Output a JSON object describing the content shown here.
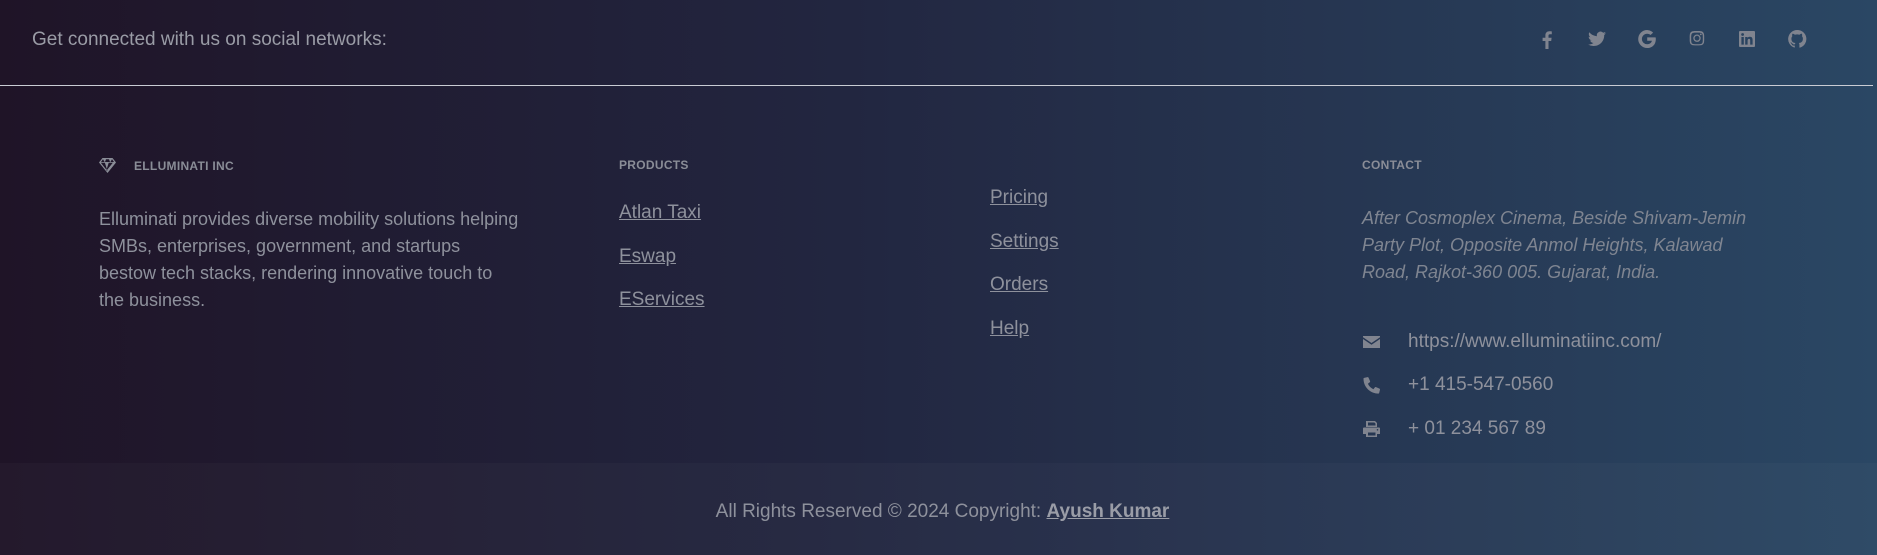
{
  "topbar": {
    "connect_text": "Get connected with us on social networks:",
    "social_icons": [
      "facebook-icon",
      "twitter-icon",
      "google-icon",
      "instagram-icon",
      "linkedin-icon",
      "github-icon"
    ]
  },
  "company": {
    "name": "ELLUMINATI INC",
    "logo_icon": "gem-icon",
    "description": "Elluminati provides diverse mobility solutions helping SMBs, enterprises, government, and startups bestow tech stacks, rendering innovative touch to the business."
  },
  "products": {
    "heading": "PRODUCTS",
    "items": [
      "Atlan Taxi",
      "Eswap",
      "EServices"
    ]
  },
  "useful_links": {
    "items": [
      "Pricing",
      "Settings",
      "Orders",
      "Help"
    ]
  },
  "contact": {
    "heading": "CONTACT",
    "address": "After Cosmoplex Cinema, Beside Shivam-Jemin Party Plot, Opposite Anmol Heights, Kalawad Road, Rajkot-360 005. Gujarat, India.",
    "website": "https://www.elluminatiinc.com/",
    "phone": "+1 415-547-0560",
    "fax": "+ 01 234 567 89"
  },
  "footer": {
    "copyright_text": "All Rights Reserved © 2024 Copyright: ",
    "author": "Ayush Kumar"
  },
  "colors": {
    "gradient_start": "#1f1427",
    "gradient_end": "#2a4764",
    "text": "#8e919c"
  }
}
